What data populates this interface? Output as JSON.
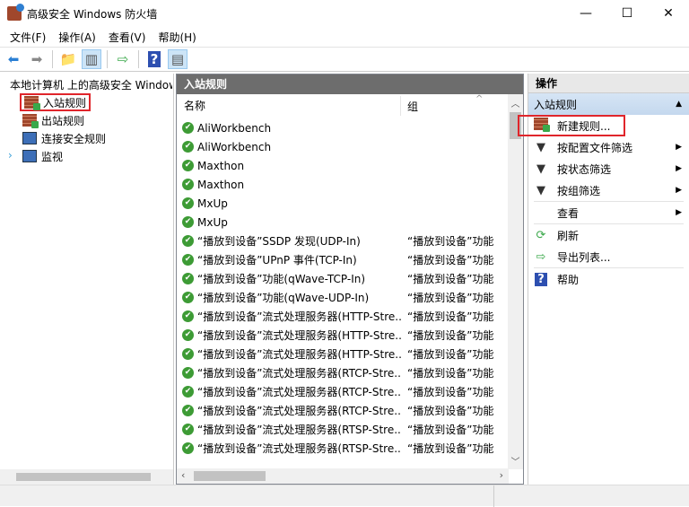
{
  "window": {
    "title": "高级安全 Windows 防火墙",
    "minimize": "—",
    "maximize": "☐",
    "close": "✕"
  },
  "menu": [
    "文件(F)",
    "操作(A)",
    "查看(V)",
    "帮助(H)"
  ],
  "tree": {
    "root": "本地计算机 上的高级安全 Windows 防火墙",
    "items": [
      "入站规则",
      "出站规则",
      "连接安全规则",
      "监视"
    ],
    "selected": "入站规则"
  },
  "middle": {
    "title": "入站规则",
    "columns": [
      "名称",
      "组"
    ],
    "rows": [
      {
        "name": "AliWorkbench",
        "group": ""
      },
      {
        "name": "AliWorkbench",
        "group": ""
      },
      {
        "name": "Maxthon",
        "group": ""
      },
      {
        "name": "Maxthon",
        "group": ""
      },
      {
        "name": "MxUp",
        "group": ""
      },
      {
        "name": "MxUp",
        "group": ""
      },
      {
        "name": "“播放到设备”SSDP 发现(UDP-In)",
        "group": "“播放到设备”功能"
      },
      {
        "name": "“播放到设备”UPnP 事件(TCP-In)",
        "group": "“播放到设备”功能"
      },
      {
        "name": "“播放到设备”功能(qWave-TCP-In)",
        "group": "“播放到设备”功能"
      },
      {
        "name": "“播放到设备”功能(qWave-UDP-In)",
        "group": "“播放到设备”功能"
      },
      {
        "name": "“播放到设备”流式处理服务器(HTTP-Stre...",
        "group": "“播放到设备”功能"
      },
      {
        "name": "“播放到设备”流式处理服务器(HTTP-Stre...",
        "group": "“播放到设备”功能"
      },
      {
        "name": "“播放到设备”流式处理服务器(HTTP-Stre...",
        "group": "“播放到设备”功能"
      },
      {
        "name": "“播放到设备”流式处理服务器(RTCP-Stre...",
        "group": "“播放到设备”功能"
      },
      {
        "name": "“播放到设备”流式处理服务器(RTCP-Stre...",
        "group": "“播放到设备”功能"
      },
      {
        "name": "“播放到设备”流式处理服务器(RTCP-Stre...",
        "group": "“播放到设备”功能"
      },
      {
        "name": "“播放到设备”流式处理服务器(RTSP-Stre...",
        "group": "“播放到设备”功能"
      },
      {
        "name": "“播放到设备”流式处理服务器(RTSP-Stre...",
        "group": "“播放到设备”功能"
      },
      {
        "name": "“播放到设备”流式处理服务器(RTSP-Stre...",
        "group": "“播放到设备”功能"
      }
    ]
  },
  "actions": {
    "title": "操作",
    "section": "入站规则",
    "items": [
      {
        "label": "新建规则...",
        "icon": "new-rule-icon",
        "submenu": false
      },
      {
        "label": "按配置文件筛选",
        "icon": "filter-icon",
        "submenu": true
      },
      {
        "label": "按状态筛选",
        "icon": "filter-icon",
        "submenu": true
      },
      {
        "label": "按组筛选",
        "icon": "filter-icon",
        "submenu": true
      },
      {
        "label": "查看",
        "icon": "",
        "submenu": true
      },
      {
        "label": "刷新",
        "icon": "refresh-icon",
        "submenu": false
      },
      {
        "label": "导出列表...",
        "icon": "export-icon",
        "submenu": false
      },
      {
        "label": "帮助",
        "icon": "help-icon",
        "submenu": false
      }
    ]
  },
  "colors": {
    "highlight": "#e0252b",
    "pane_header": "#6d6d6d",
    "check": "#3d9b35"
  }
}
